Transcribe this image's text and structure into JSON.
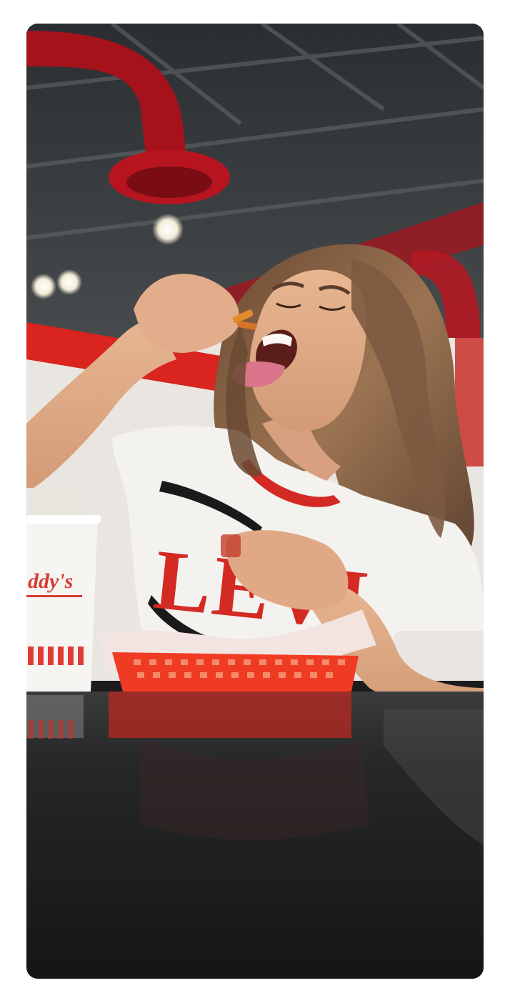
{
  "photo": {
    "subject": "person-eating-fries",
    "colors": {
      "ceiling": "#2f3336",
      "duct_red": "#b3141f",
      "wall_red": "#d9241f",
      "shirt": "#f4f2ef",
      "shirt_print": "#d42a24",
      "hair": "#8a6446",
      "skin": "#e0a885",
      "basket": "#ef3b24",
      "table": "#1d1e20"
    },
    "cup_text": "ddy's",
    "shirt_text": "LEVI"
  }
}
